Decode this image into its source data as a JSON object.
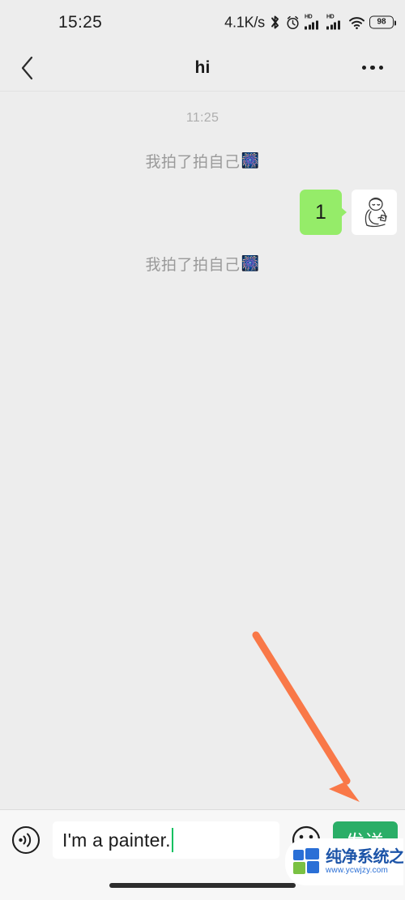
{
  "status_bar": {
    "time": "15:25",
    "network_speed": "4.1K/s",
    "bluetooth_icon": "bluetooth-icon",
    "alarm_icon": "alarm-clock-icon",
    "signal_1_label": "HD",
    "signal_2_label": "HD",
    "wifi_icon": "wifi-icon",
    "battery_level": "98"
  },
  "nav_bar": {
    "back_icon": "back-chevron-icon",
    "title": "hi",
    "more_icon": "more-options-icon"
  },
  "chat": {
    "timestamp": "11:25",
    "messages": [
      {
        "type": "system",
        "text": "我拍了拍自己",
        "emoji": "🎆"
      },
      {
        "type": "bubble",
        "text": "1",
        "avatar_icon": "person-line-art-avatar"
      },
      {
        "type": "system",
        "text": "我拍了拍自己",
        "emoji": "🎆"
      }
    ]
  },
  "annotation": {
    "arrow_icon": "orange-arrow-pointing-to-send",
    "color": "#f97848"
  },
  "input_bar": {
    "voice_icon": "voice-message-icon",
    "input_value": "I'm a painter.",
    "input_placeholder": "",
    "emoji_icon": "smiley-face-icon",
    "send_label": "发送"
  },
  "watermark": {
    "name": "纯净系统之家",
    "url": "www.ycwjzy.com",
    "logo_icon": "squares-logo-icon"
  },
  "colors": {
    "background": "#ededed",
    "bubble_green": "#95ec69",
    "send_green": "#2aae67",
    "caret_green": "#07c160",
    "arrow_orange": "#f97848"
  },
  "home_indicator": "home-indicator-bar"
}
